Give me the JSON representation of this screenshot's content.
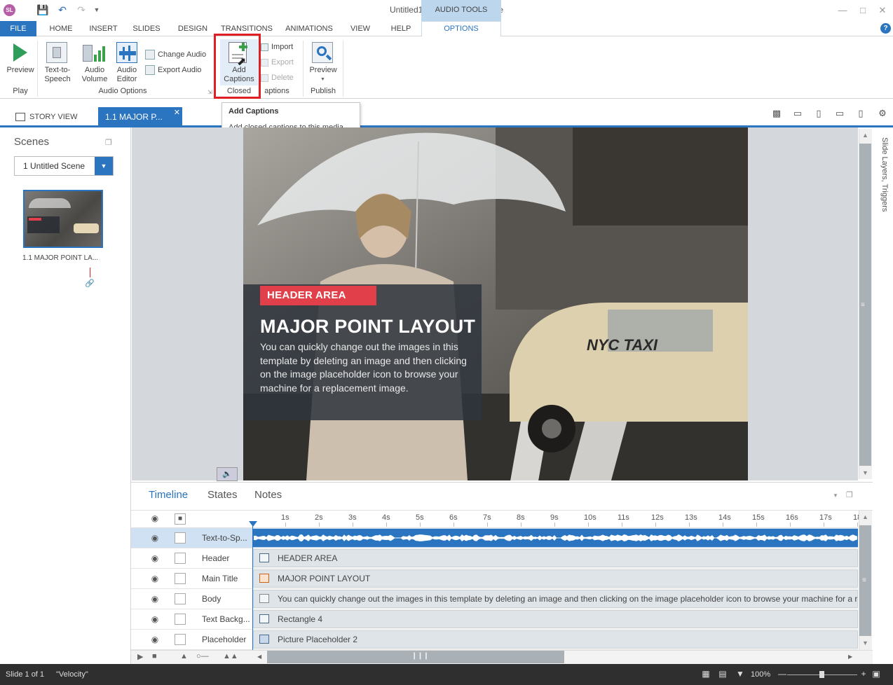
{
  "app": {
    "window_title": "Untitled1* - Articulate Storyline",
    "logo_text": "SL",
    "contextual_group": "AUDIO TOOLS"
  },
  "tabs": {
    "file": "FILE",
    "items": [
      "HOME",
      "INSERT",
      "SLIDES",
      "DESIGN",
      "TRANSITIONS",
      "ANIMATIONS",
      "VIEW",
      "HELP"
    ],
    "options": "OPTIONS"
  },
  "ribbon": {
    "preview": "Preview",
    "play_group": "Play",
    "text_to_speech": [
      "Text-to-",
      "Speech"
    ],
    "audio_volume": [
      "Audio",
      "Volume"
    ],
    "audio_editor": [
      "Audio",
      "Editor"
    ],
    "change_audio": "Change Audio",
    "export_audio": "Export Audio",
    "audio_options_group": "Audio Options",
    "add_captions": [
      "Add",
      "Captions"
    ],
    "import": "Import",
    "export": "Export",
    "delete": "Delete",
    "closed_captions_group_a": "Closed",
    "closed_captions_group_b": "aptions",
    "preview2": "Preview",
    "publish_group": "Publish"
  },
  "tooltip": {
    "title": "Add Captions",
    "description": "Add closed captions to this media."
  },
  "viewbar": {
    "story_view": "STORY VIEW",
    "slide_tab": "1.1 MAJOR P..."
  },
  "scenes": {
    "title": "Scenes",
    "selected_scene": "1 Untitled Scene",
    "thumb_label": "1.1 MAJOR  POINT  LA..."
  },
  "slide": {
    "header_area": "HEADER AREA",
    "title": "MAJOR POINT LAYOUT",
    "body": "You can quickly change out the images in this template by deleting an image and then clicking on the image placeholder icon to browse your machine for a replacement image.",
    "taxi_text": "NYC TAXI"
  },
  "right_panel": {
    "label": "Slide Layers, Triggers"
  },
  "timeline": {
    "tabs": [
      "Timeline",
      "States",
      "Notes"
    ],
    "ticks": [
      "1s",
      "2s",
      "3s",
      "4s",
      "5s",
      "6s",
      "7s",
      "8s",
      "9s",
      "10s",
      "11s",
      "12s",
      "13s",
      "14s",
      "15s",
      "16s",
      "17s",
      "18"
    ],
    "rows": [
      {
        "name": "Text-to-Sp...",
        "bar": ""
      },
      {
        "name": "Header",
        "bar": "HEADER AREA"
      },
      {
        "name": "Main Title",
        "bar": "MAJOR POINT LAYOUT"
      },
      {
        "name": "Body",
        "bar": "You can quickly change out the images in this template by deleting an image and then clicking on the image placeholder icon to browse your machine for a r"
      },
      {
        "name": "Text Backg...",
        "bar": "Rectangle 4"
      },
      {
        "name": "Placeholder",
        "bar": "Picture Placeholder 2"
      }
    ]
  },
  "status": {
    "slide": "Slide 1 of 1",
    "theme": "\"Velocity\"",
    "zoom": "100%"
  }
}
